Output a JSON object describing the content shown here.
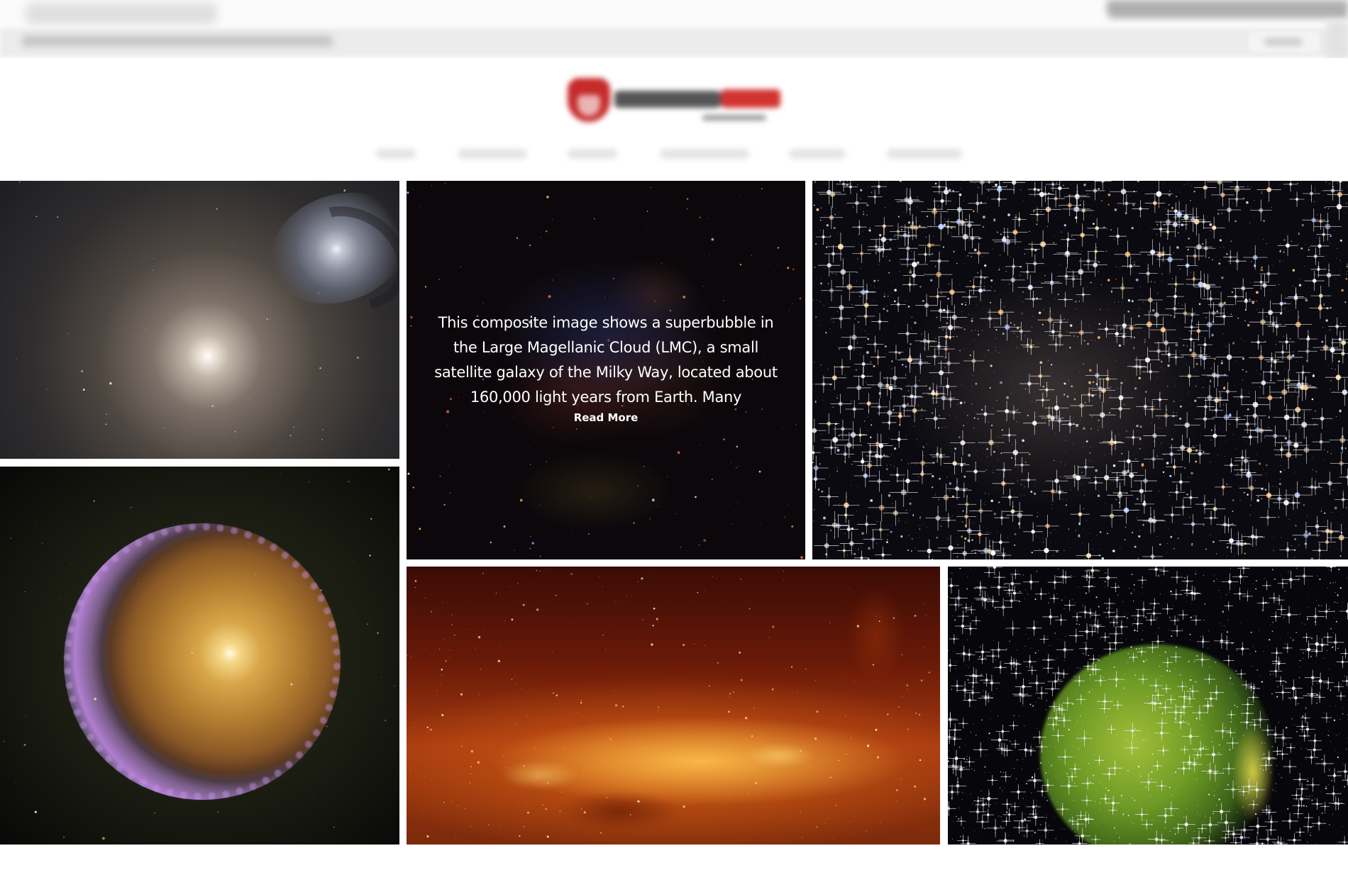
{
  "header": {
    "logo_name": "site-logo"
  },
  "gallery": {
    "featured": {
      "caption": "This composite image shows a superbubble in the Large Magellanic Cloud (LMC), a small satellite galaxy of the Milky Way, located about 160,000 light years from Earth. Many",
      "read_more": "Read More"
    },
    "tiles": [
      {
        "name": "elliptical-and-spiral-galaxy-image"
      },
      {
        "name": "lmc-superbubble-image"
      },
      {
        "name": "globular-star-cluster-image"
      },
      {
        "name": "ring-spiral-galaxy-image"
      },
      {
        "name": "infrared-galactic-center-image"
      },
      {
        "name": "green-supernova-remnant-image"
      }
    ]
  },
  "colors": {
    "background": "#ffffff",
    "caption_text": "#ffffff",
    "logo_red": "#c62a2a"
  }
}
